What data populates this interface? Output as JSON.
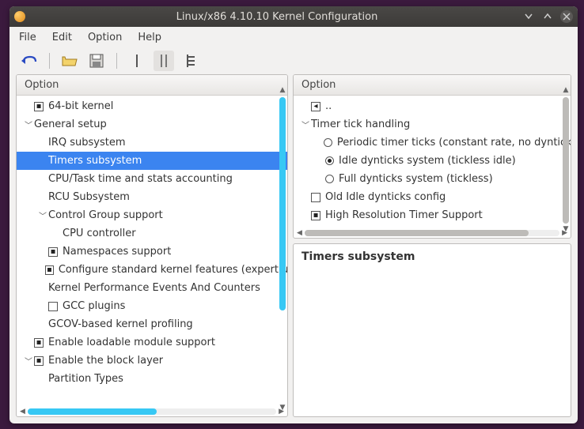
{
  "window": {
    "title": "Linux/x86 4.10.10 Kernel Configuration"
  },
  "menu": {
    "file": "File",
    "edit": "Edit",
    "option": "Option",
    "help": "Help"
  },
  "columns": {
    "option": "Option"
  },
  "left_tree": [
    {
      "depth": 0,
      "expander": "",
      "check": "dot",
      "label": "64-bit kernel"
    },
    {
      "depth": 0,
      "expander": "v",
      "check": "none",
      "label": "General setup"
    },
    {
      "depth": 1,
      "expander": "",
      "check": "none",
      "label": "IRQ subsystem"
    },
    {
      "depth": 1,
      "expander": "",
      "check": "none",
      "label": "Timers subsystem",
      "selected": true
    },
    {
      "depth": 1,
      "expander": "",
      "check": "none",
      "label": "CPU/Task time and stats accounting"
    },
    {
      "depth": 1,
      "expander": "",
      "check": "none",
      "label": "RCU Subsystem"
    },
    {
      "depth": 1,
      "expander": "v",
      "check": "none",
      "label": "Control Group support"
    },
    {
      "depth": 2,
      "expander": "",
      "check": "none",
      "label": "CPU controller"
    },
    {
      "depth": 1,
      "expander": "",
      "check": "dot",
      "label": "Namespaces support"
    },
    {
      "depth": 1,
      "expander": "",
      "check": "dot",
      "label": "Configure standard kernel features (expert users)"
    },
    {
      "depth": 1,
      "expander": "",
      "check": "none",
      "label": "Kernel Performance Events And Counters"
    },
    {
      "depth": 1,
      "expander": "",
      "check": "empty",
      "label": "GCC plugins"
    },
    {
      "depth": 1,
      "expander": "",
      "check": "none",
      "label": "GCOV-based kernel profiling"
    },
    {
      "depth": 0,
      "expander": "",
      "check": "dot",
      "label": "Enable loadable module support"
    },
    {
      "depth": 0,
      "expander": "v",
      "check": "dot",
      "label": "Enable the block layer"
    },
    {
      "depth": 1,
      "expander": "",
      "check": "none",
      "label": "Partition Types"
    }
  ],
  "right_tree": [
    {
      "depth": 0,
      "expander": "",
      "kind": "back",
      "label": ".."
    },
    {
      "depth": 0,
      "expander": "v",
      "kind": "plain",
      "label": "Timer tick handling"
    },
    {
      "depth": 1,
      "expander": "",
      "kind": "radio",
      "sel": false,
      "label": "Periodic timer ticks (constant rate, no dynticks)"
    },
    {
      "depth": 1,
      "expander": "",
      "kind": "radio",
      "sel": true,
      "label": "Idle dynticks system (tickless idle)"
    },
    {
      "depth": 1,
      "expander": "",
      "kind": "radio",
      "sel": false,
      "label": "Full dynticks system (tickless)"
    },
    {
      "depth": 0,
      "expander": "",
      "kind": "empty",
      "label": "Old Idle dynticks config"
    },
    {
      "depth": 0,
      "expander": "",
      "kind": "dot",
      "label": "High Resolution Timer Support"
    }
  ],
  "detail": {
    "title": "Timers subsystem"
  }
}
